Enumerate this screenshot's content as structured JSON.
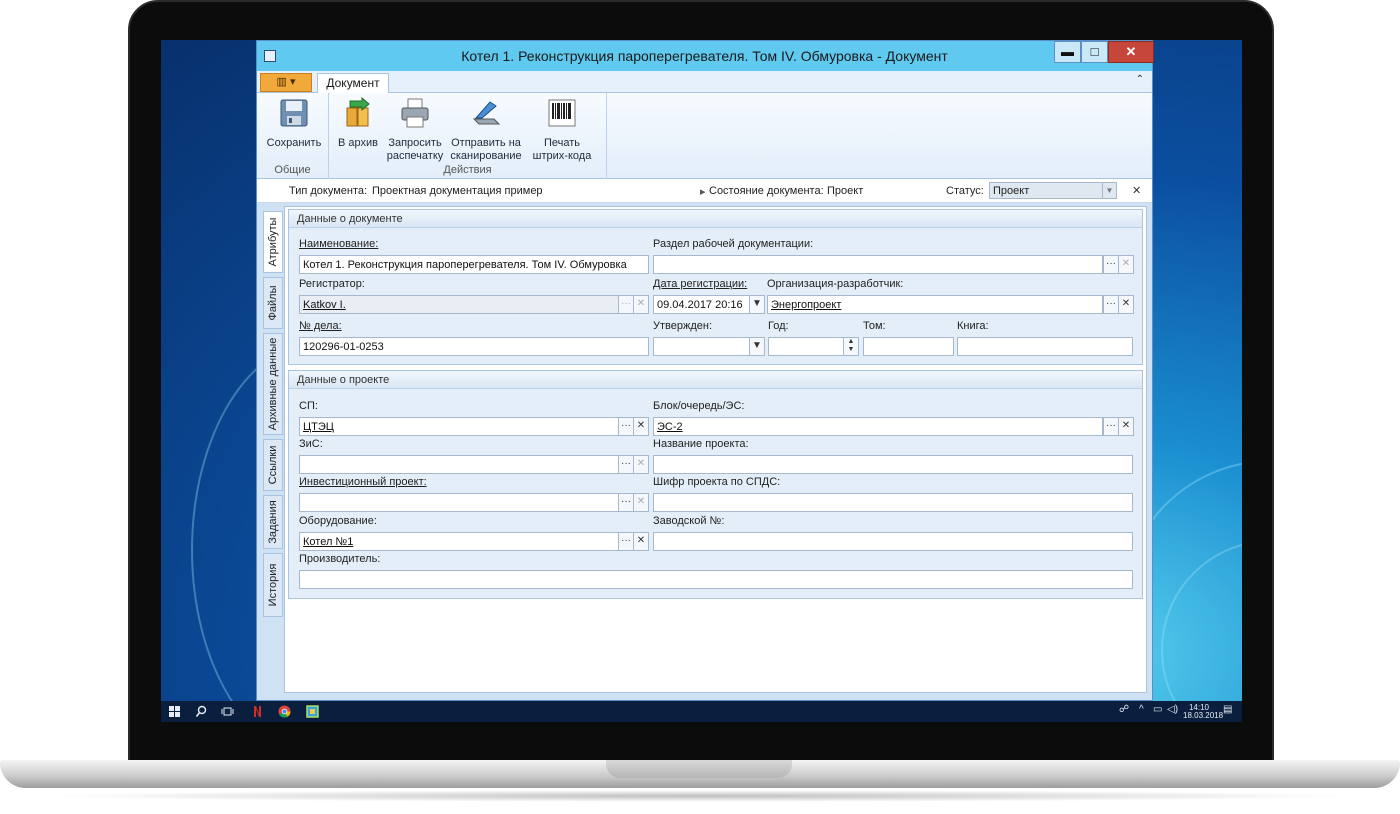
{
  "window": {
    "title": "Котел 1. Реконструкция пароперегревателя. Том IV. Обмуровка - Документ",
    "min": "▬",
    "max": "□",
    "close": "✕"
  },
  "ribbon": {
    "tab": "Документ",
    "groups": [
      {
        "label": "Общие",
        "buttons": [
          "Сохранить"
        ]
      },
      {
        "label": "Действия",
        "buttons": [
          "В архив",
          "Запросить\nраспечатку",
          "Отправить на\nсканирование",
          "Печать\nштрих-кода"
        ]
      }
    ],
    "save": "Сохранить",
    "archive": "В архив",
    "print_request_1": "Запросить",
    "print_request_2": "распечатку",
    "scan_1": "Отправить на",
    "scan_2": "сканирование",
    "barcode_1": "Печать",
    "barcode_2": "штрих-кода",
    "group_general": "Общие",
    "group_actions": "Действия"
  },
  "info": {
    "doc_type_label": "Тип документа:",
    "doc_type_value": "Проектная документация пример",
    "state_label": "Состояние документа:",
    "state_value": "Проект",
    "status_label": "Статус:",
    "status_value": "Проект"
  },
  "side_tabs": [
    "Атрибуты",
    "Файлы",
    "Архивные данные",
    "Ссылки",
    "Задания",
    "История"
  ],
  "doc_panel": {
    "title": "Данные о документе",
    "name_label": "Наименование:",
    "name_value": "Котел 1. Реконструкция пароперегревателя. Том IV. Обмуровка",
    "section_label": "Раздел рабочей документации:",
    "section_value": "",
    "registrar_label": "Регистратор:",
    "registrar_value": "Katkov I.",
    "reg_date_label": "Дата регистрации:",
    "reg_date_value": "09.04.2017 20:16",
    "org_label": "Организация-разработчик:",
    "org_value": "Энергопроект",
    "case_label": "№ дела:",
    "case_value": "120296-01-0253",
    "approved_label": "Утвержден:",
    "year_label": "Год:",
    "volume_label": "Том:",
    "book_label": "Книга:"
  },
  "project_panel": {
    "title": "Данные о проекте",
    "sp_label": "СП:",
    "sp_value": "ЦТЭЦ",
    "block_label": "Блок/очередь/ЭС:",
    "block_value": "ЭС-2",
    "zis_label": "ЗиС:",
    "project_name_label": "Название проекта:",
    "invest_label": "Инвестиционный проект:",
    "code_label": "Шифр проекта по СПДС:",
    "equipment_label": "Оборудование:",
    "equipment_value": "Котел №1",
    "serial_label": "Заводской №:",
    "manufacturer_label": "Производитель:"
  },
  "taskbar": {
    "time": "14:10",
    "date": "18.03.2018"
  },
  "colors": {
    "titlebar": "#5fc9ef",
    "close_button": "#c7463b",
    "app_menu": "#f2a93b",
    "window_bg": "#cfe2f3"
  },
  "icons": [
    "save-icon",
    "archive-icon",
    "printer-icon",
    "scanner-icon",
    "barcode-icon",
    "windows-start-icon",
    "search-icon",
    "chrome-icon"
  ]
}
